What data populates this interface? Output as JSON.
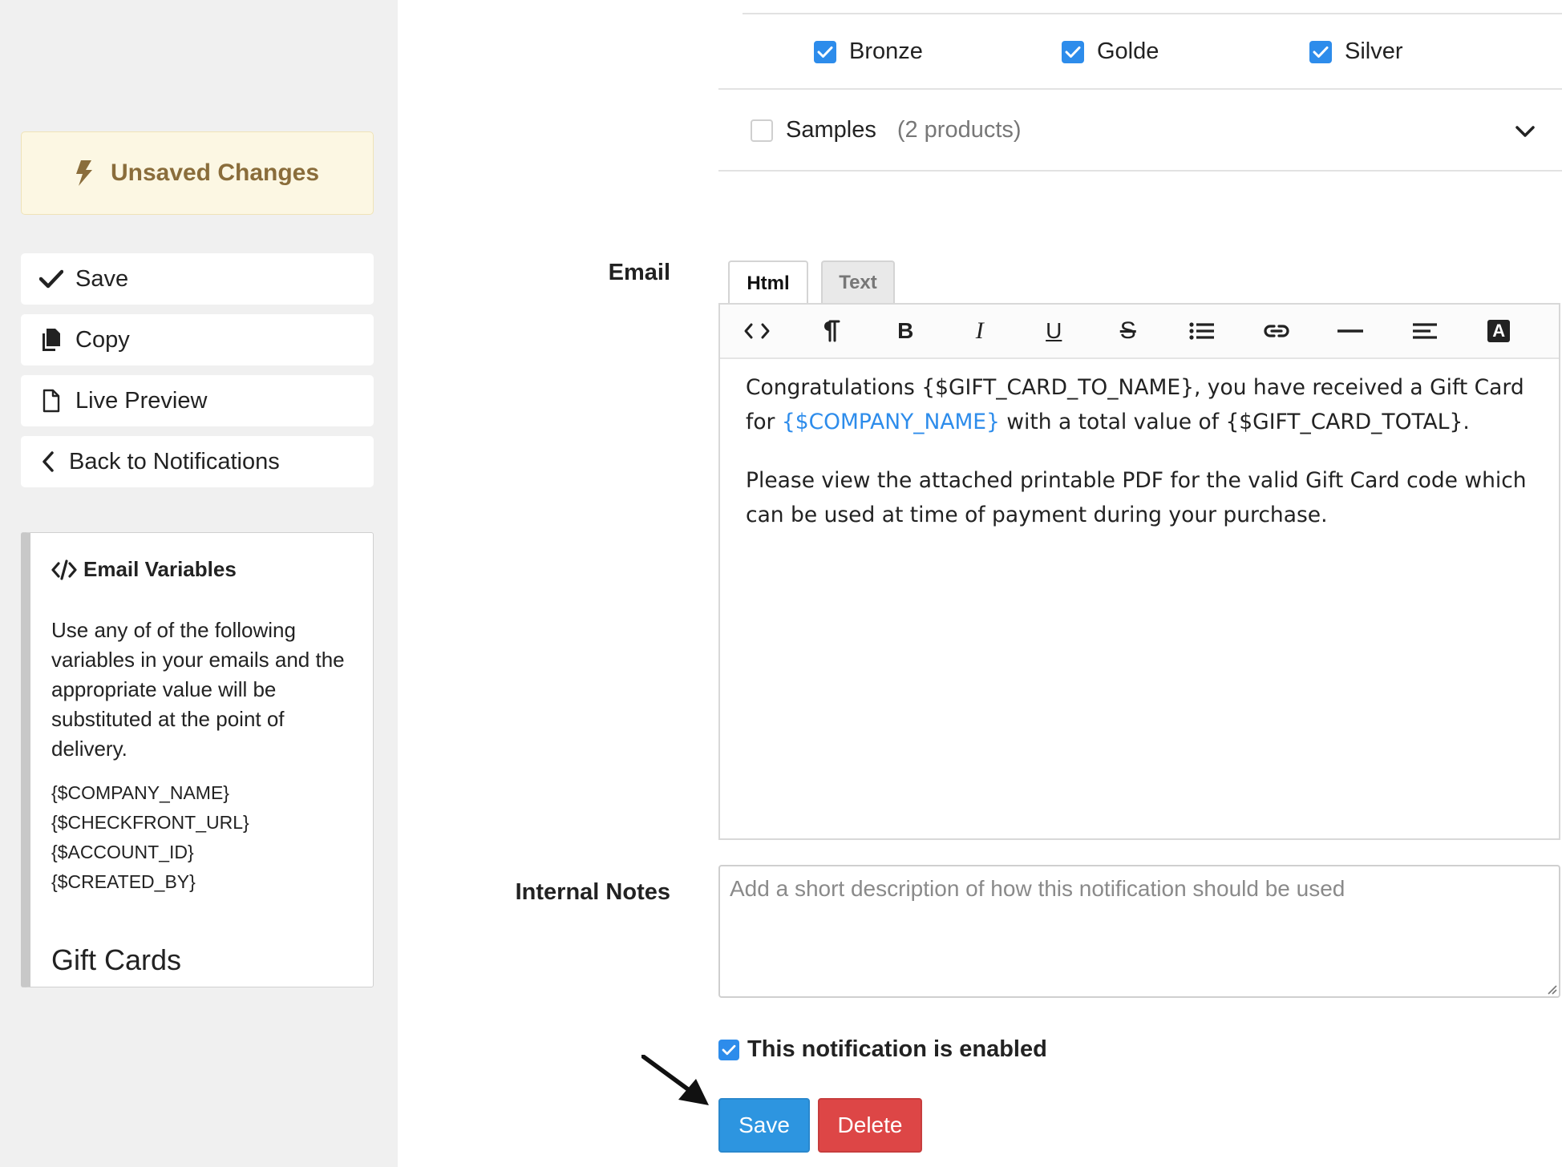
{
  "sidebar": {
    "unsaved_label": "Unsaved Changes",
    "buttons": {
      "save": "Save",
      "copy": "Copy",
      "live_preview": "Live Preview",
      "back": "Back to Notifications"
    },
    "variables_panel": {
      "title": "Email Variables",
      "description": "Use any of of the following variables in your emails and the appropriate value will be substituted at the point of delivery.",
      "variables": [
        "{$COMPANY_NAME}",
        "{$CHECKFRONT_URL}",
        "{$ACCOUNT_ID}",
        "{$CREATED_BY}"
      ],
      "section_heading": "Gift Cards"
    }
  },
  "groups": {
    "items": [
      {
        "label": "Bronze",
        "checked": true
      },
      {
        "label": "Golde",
        "checked": true
      },
      {
        "label": "Silver",
        "checked": true
      }
    ],
    "samples": {
      "label": "Samples",
      "count": "(2 products)",
      "checked": false
    }
  },
  "email": {
    "label": "Email",
    "tabs": {
      "html": "Html",
      "text": "Text"
    },
    "active_tab": "Html",
    "toolbar": [
      "code-view",
      "paragraph",
      "bold",
      "italic",
      "underline",
      "strikethrough",
      "list",
      "link",
      "horizontal-rule",
      "align",
      "font-color"
    ],
    "toolbar_labels": {
      "bold": "B",
      "italic": "I",
      "underline": "U",
      "strike": "S",
      "font_color": "A"
    },
    "body": {
      "p1_start": "Congratulations {$GIFT_CARD_TO_NAME}, you have received a Gift Card for ",
      "p1_var": "{$COMPANY_NAME}",
      "p1_end": " with a total value of {$GIFT_CARD_TOTAL}.",
      "p2": "Please view the attached printable PDF for the valid Gift Card code which can be used at time of payment during your purchase."
    }
  },
  "internal_notes": {
    "label": "Internal Notes",
    "placeholder": "Add a short description of how this notification should be used",
    "value": ""
  },
  "enabled": {
    "label": "This notification is enabled",
    "checked": true
  },
  "actions": {
    "save": "Save",
    "delete": "Delete"
  },
  "colors": {
    "accent": "#2d8ceb",
    "save_button": "#2d95e0",
    "delete_button": "#dd4646",
    "unsaved_bg": "#fcf7e3",
    "unsaved_text": "#8a6d3b",
    "sidebar_bg": "#f0f0f0"
  }
}
